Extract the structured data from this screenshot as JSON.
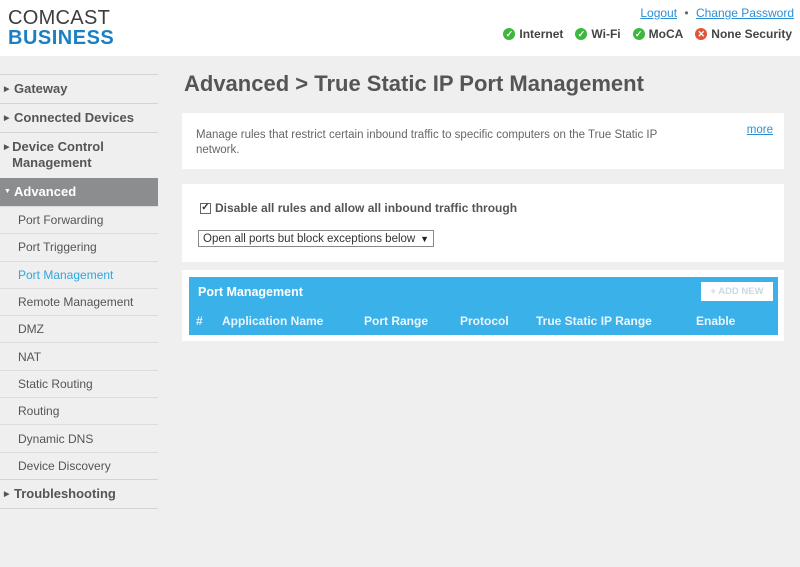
{
  "header": {
    "logo_line1": "COMCAST",
    "logo_line2": "BUSINESS",
    "links": {
      "logout": "Logout",
      "separator": "•",
      "change_password": "Change Password"
    },
    "status": [
      {
        "label": "Internet",
        "state": "ok",
        "icon": "check-icon",
        "color": "#3cb83c"
      },
      {
        "label": "Wi-Fi",
        "state": "ok",
        "icon": "check-icon",
        "color": "#3cb83c"
      },
      {
        "label": "MoCA",
        "state": "ok",
        "icon": "check-icon",
        "color": "#3cb83c"
      },
      {
        "label": "None Security",
        "state": "bad",
        "icon": "x-icon",
        "color": "#e0553a"
      }
    ]
  },
  "sidebar": {
    "main_items": [
      {
        "label": "Gateway"
      },
      {
        "label": "Connected Devices"
      },
      {
        "label": "Device Control Management"
      },
      {
        "label": "Advanced"
      },
      {
        "label": "Troubleshooting"
      }
    ],
    "advanced_items": [
      {
        "label": "Port Forwarding"
      },
      {
        "label": "Port Triggering"
      },
      {
        "label": "Port Management"
      },
      {
        "label": "Remote Management"
      },
      {
        "label": "DMZ"
      },
      {
        "label": "NAT"
      },
      {
        "label": "Static Routing"
      },
      {
        "label": "Routing"
      },
      {
        "label": "Dynamic DNS"
      },
      {
        "label": "Device Discovery"
      }
    ],
    "active_main": "Advanced",
    "selected_sub": "Port Management"
  },
  "main": {
    "title": "Advanced > True Static IP Port Management",
    "info": {
      "text": "Manage rules that restrict certain inbound traffic to specific computers on the True Static IP network.",
      "more_label": "more"
    },
    "options": {
      "checkbox_label": "Disable all rules and allow all inbound traffic through",
      "checkbox_checked": true,
      "select_value": "Open all ports but block exceptions below"
    },
    "table": {
      "title": "Port Management",
      "add_button": "+ ADD NEW",
      "columns": [
        "#",
        "Application Name",
        "Port Range",
        "Protocol",
        "True Static IP Range",
        "Enable"
      ],
      "rows": []
    }
  },
  "colors": {
    "accent_blue": "#3ab1e8",
    "link_blue": "#2c8fd6",
    "active_nav_bg": "#8b8d8f",
    "brand_blue": "#1b7fc4"
  }
}
